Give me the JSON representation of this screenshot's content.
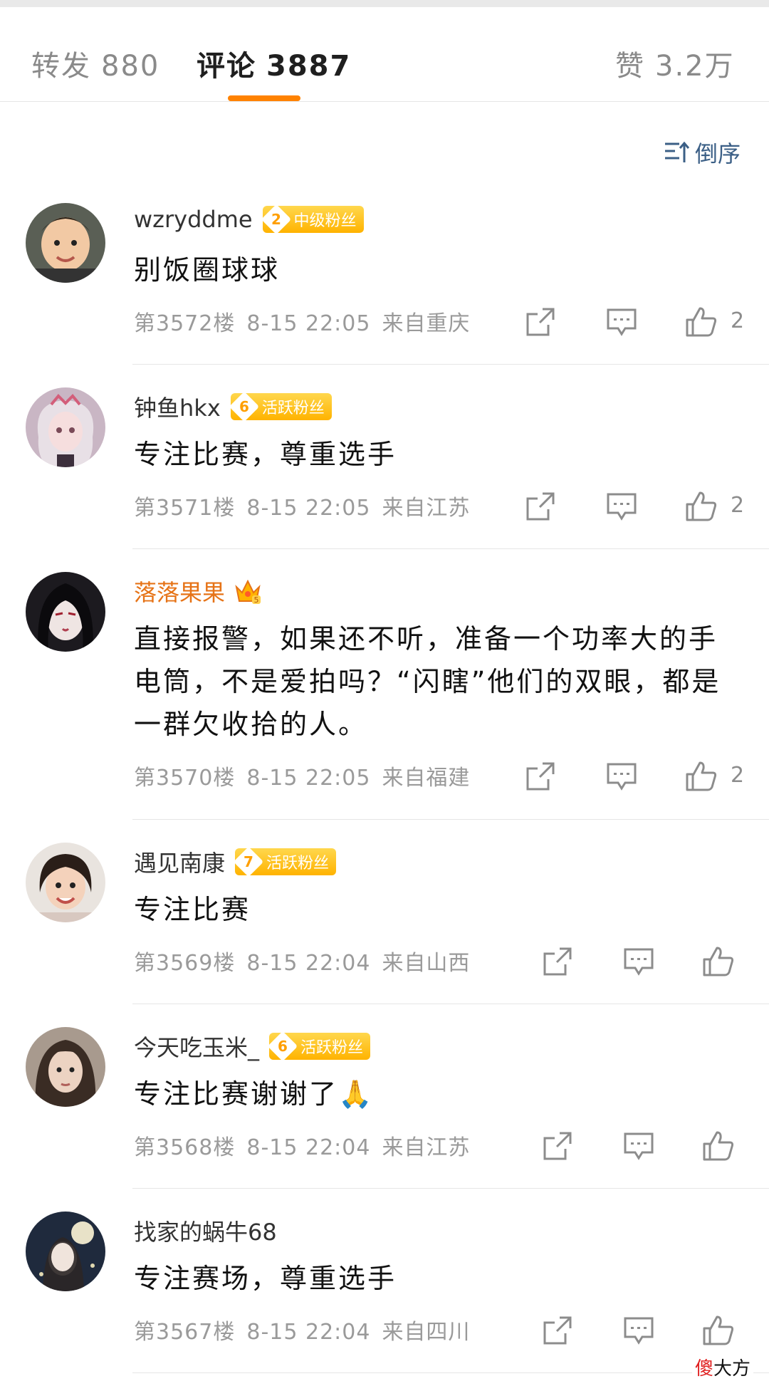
{
  "tabs": [
    {
      "label": "转发",
      "count": "880"
    },
    {
      "label": "评论",
      "count": "3887"
    },
    {
      "label": "赞",
      "count": "3.2万"
    }
  ],
  "sort": {
    "label": "倒序",
    "icon": "sort-desc-icon"
  },
  "comments": [
    {
      "user": "wzryddme",
      "badge_level": "2",
      "badge_label": "中级粉丝",
      "text": "别饭圈球球",
      "floor": "第3572楼",
      "time": "8-15 22:05",
      "location": "来自重庆",
      "likes": "2"
    },
    {
      "user": "钟鱼hkx",
      "badge_level": "6",
      "badge_label": "活跃粉丝",
      "text": "专注比赛，尊重选手",
      "floor": "第3571楼",
      "time": "8-15 22:05",
      "location": "来自江苏",
      "likes": "2"
    },
    {
      "user": "落落果果",
      "crown_level": "5",
      "text": "直接报警，如果还不听，准备一个功率大的手电筒，不是爱拍吗？“闪瞎”他们的双眼，都是一群欠收拾的人。",
      "floor": "第3570楼",
      "time": "8-15 22:05",
      "location": "来自福建",
      "likes": "2"
    },
    {
      "user": "遇见南康",
      "badge_level": "7",
      "badge_label": "活跃粉丝",
      "text": "专注比赛",
      "floor": "第3569楼",
      "time": "8-15 22:04",
      "location": "来自山西",
      "likes": ""
    },
    {
      "user": "今天吃玉米_",
      "badge_level": "6",
      "badge_label": "活跃粉丝",
      "text": "专注比赛谢谢了🙏",
      "floor": "第3568楼",
      "time": "8-15 22:04",
      "location": "来自江苏",
      "likes": ""
    },
    {
      "user": "找家的蜗牛68",
      "text": "专注赛场，尊重选手",
      "floor": "第3567楼",
      "time": "8-15 22:04",
      "location": "来自四川",
      "likes": ""
    }
  ],
  "watermark": {
    "red": "傻",
    "black": "大方"
  },
  "colors": {
    "accent": "#ff8200",
    "gold_name": "#e67317",
    "badge": "#ffb300",
    "link": "#3b5f86"
  }
}
